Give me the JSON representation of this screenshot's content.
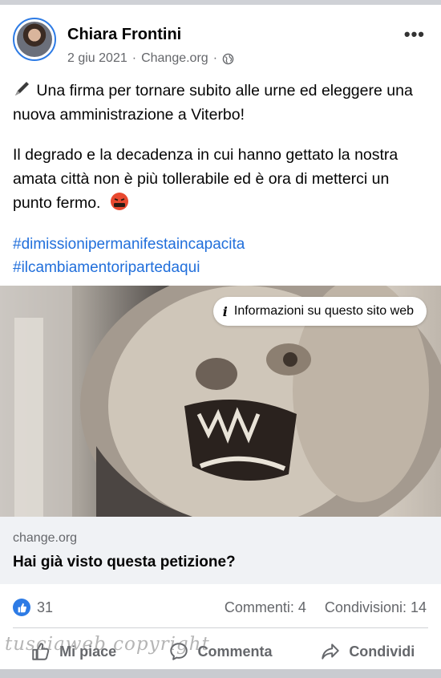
{
  "post": {
    "author": "Chiara Frontini",
    "date": "2 giu 2021",
    "dot": "·",
    "source": "Change.org",
    "privacy_icon": "globe-icon",
    "more_icon": "more-dots-icon",
    "more_label": "•••",
    "text_line_1": "Una firma per tornare subito alle urne ed eleggere una nuova amministrazione a Viterbo!",
    "text_line_2": "Il degrado e la decadenza in cui hanno gettato la nostra amata città non è più tollerabile ed è ora di metterci un punto fermo.",
    "hashtags": [
      "#dimissionipermanifestaincapacita",
      "#ilcambiamentoripartedaqui"
    ]
  },
  "link_preview": {
    "info_label": "Informazioni su questo sito web",
    "domain": "change.org",
    "title": "Hai già visto questa petizione?"
  },
  "stats": {
    "likes": "31",
    "comments": "Commenti: 4",
    "shares": "Condivisioni: 14"
  },
  "actions": {
    "like": "Mi piace",
    "comment": "Commenta",
    "share": "Condividi"
  },
  "watermark": "tusciaweb copyright",
  "colors": {
    "accent": "#2d7be5",
    "hashtag": "#216fdb",
    "muted": "#65676b"
  }
}
